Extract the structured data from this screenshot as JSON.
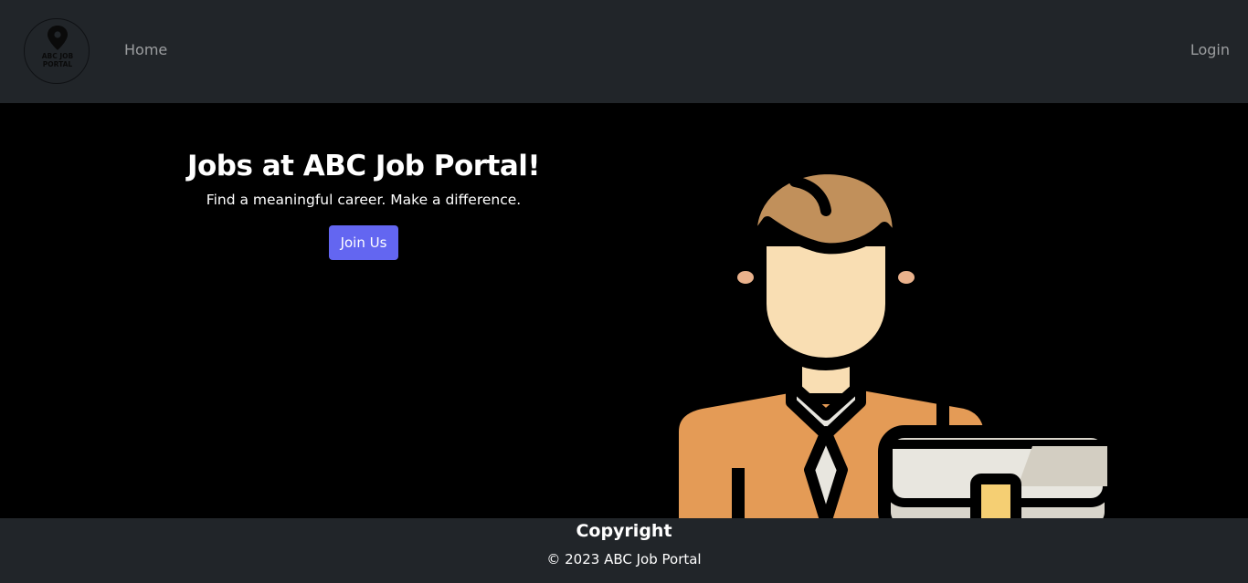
{
  "navbar": {
    "logo": {
      "line1": "ABC JOB",
      "line2": "PORTAL",
      "icon": "location-pin-icon"
    },
    "home_label": "Home",
    "login_label": "Login"
  },
  "hero": {
    "title": "Jobs at ABC Job Portal!",
    "subtitle": "Find a meaningful career. Make a difference.",
    "cta_label": "Join Us",
    "illustration": "businessman-with-briefcase"
  },
  "footer": {
    "title": "Copyright",
    "copyright": "© 2023 ABC Job Portal"
  },
  "colors": {
    "nav_bg": "#212529",
    "hero_bg": "#000000",
    "accent": "#6366f1",
    "suit": "#e49b56",
    "skin": "#f9deb3",
    "hair": "#c1905b"
  }
}
